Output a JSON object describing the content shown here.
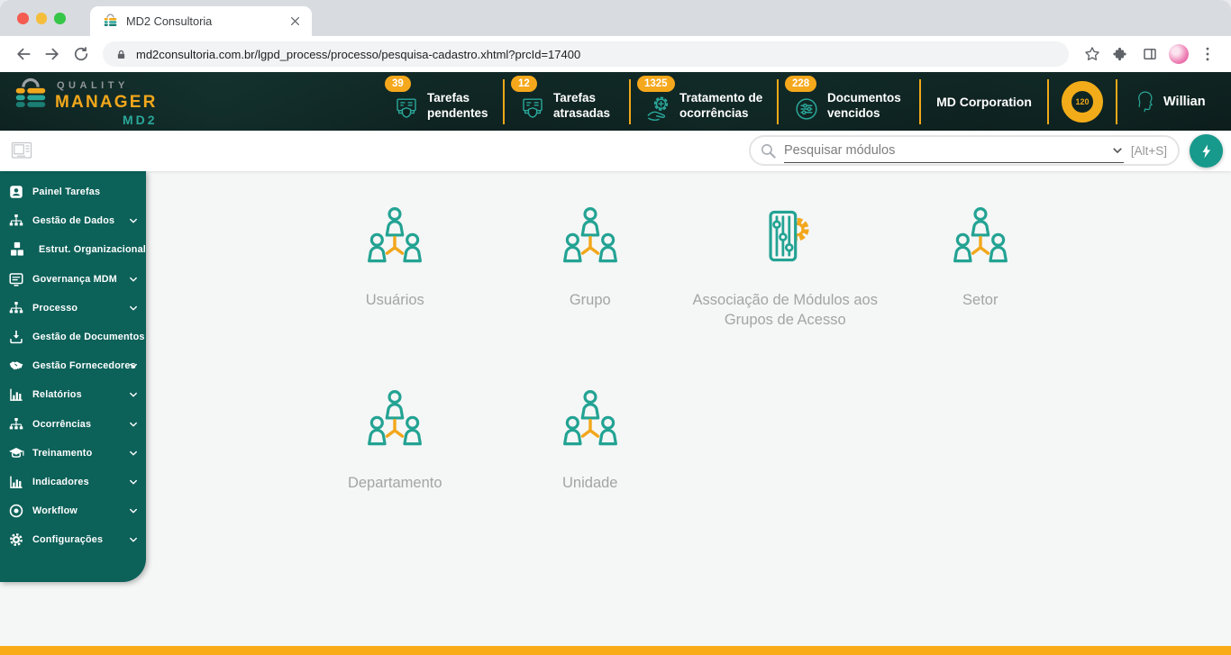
{
  "browser": {
    "tab_title": "MD2 Consultoria",
    "url": "md2consultoria.com.br/lgpd_process/processo/pesquisa-cadastro.xhtml?prcId=17400"
  },
  "header": {
    "logo": {
      "word1": "QUALITY",
      "word2": "MANAGER",
      "word3": "MD2"
    },
    "badges": [
      {
        "count": "39",
        "label": "Tarefas pendentes",
        "icon": "tasks-icon"
      },
      {
        "count": "12",
        "label": "Tarefas atrasadas",
        "icon": "tasks-icon"
      },
      {
        "count": "1325",
        "label": "Tratamento de ocorrências",
        "icon": "occurrence-hand-icon"
      },
      {
        "count": "228",
        "label": "Documentos vencidos",
        "icon": "documents-sliders-icon"
      }
    ],
    "company": "MD Corporation",
    "gauge_value": "120",
    "user_name": "Willian"
  },
  "toolbar": {
    "search_placeholder": "Pesquisar módulos",
    "shortcut": "[Alt+S]"
  },
  "sidebar": {
    "items": [
      {
        "label": "Painel Tarefas"
      },
      {
        "label": "Gestão de Dados"
      },
      {
        "label": "Estrut. Organizacional"
      },
      {
        "label": "Governança MDM"
      },
      {
        "label": "Processo"
      },
      {
        "label": "Gestão de Documentos"
      },
      {
        "label": "Gestão Fornecedores"
      },
      {
        "label": "Relatórios"
      },
      {
        "label": "Ocorrências"
      },
      {
        "label": "Treinamento"
      },
      {
        "label": "Indicadores"
      },
      {
        "label": "Workflow"
      },
      {
        "label": "Configurações"
      }
    ]
  },
  "main": {
    "cards": [
      {
        "label": "Usuários"
      },
      {
        "label": "Grupo"
      },
      {
        "label": "Associação de Módulos aos Grupos de Acesso"
      },
      {
        "label": "Setor"
      },
      {
        "label": "Departamento"
      },
      {
        "label": "Unidade"
      }
    ]
  },
  "colors": {
    "accent_orange": "#f5a81c",
    "teal_icon": "#23a393",
    "sidebar_teal": "#0c6159",
    "header_dark": "#0d1e1d",
    "bolt_button_teal": "#17998c",
    "bottom_bar_orange": "#f8ab17"
  }
}
